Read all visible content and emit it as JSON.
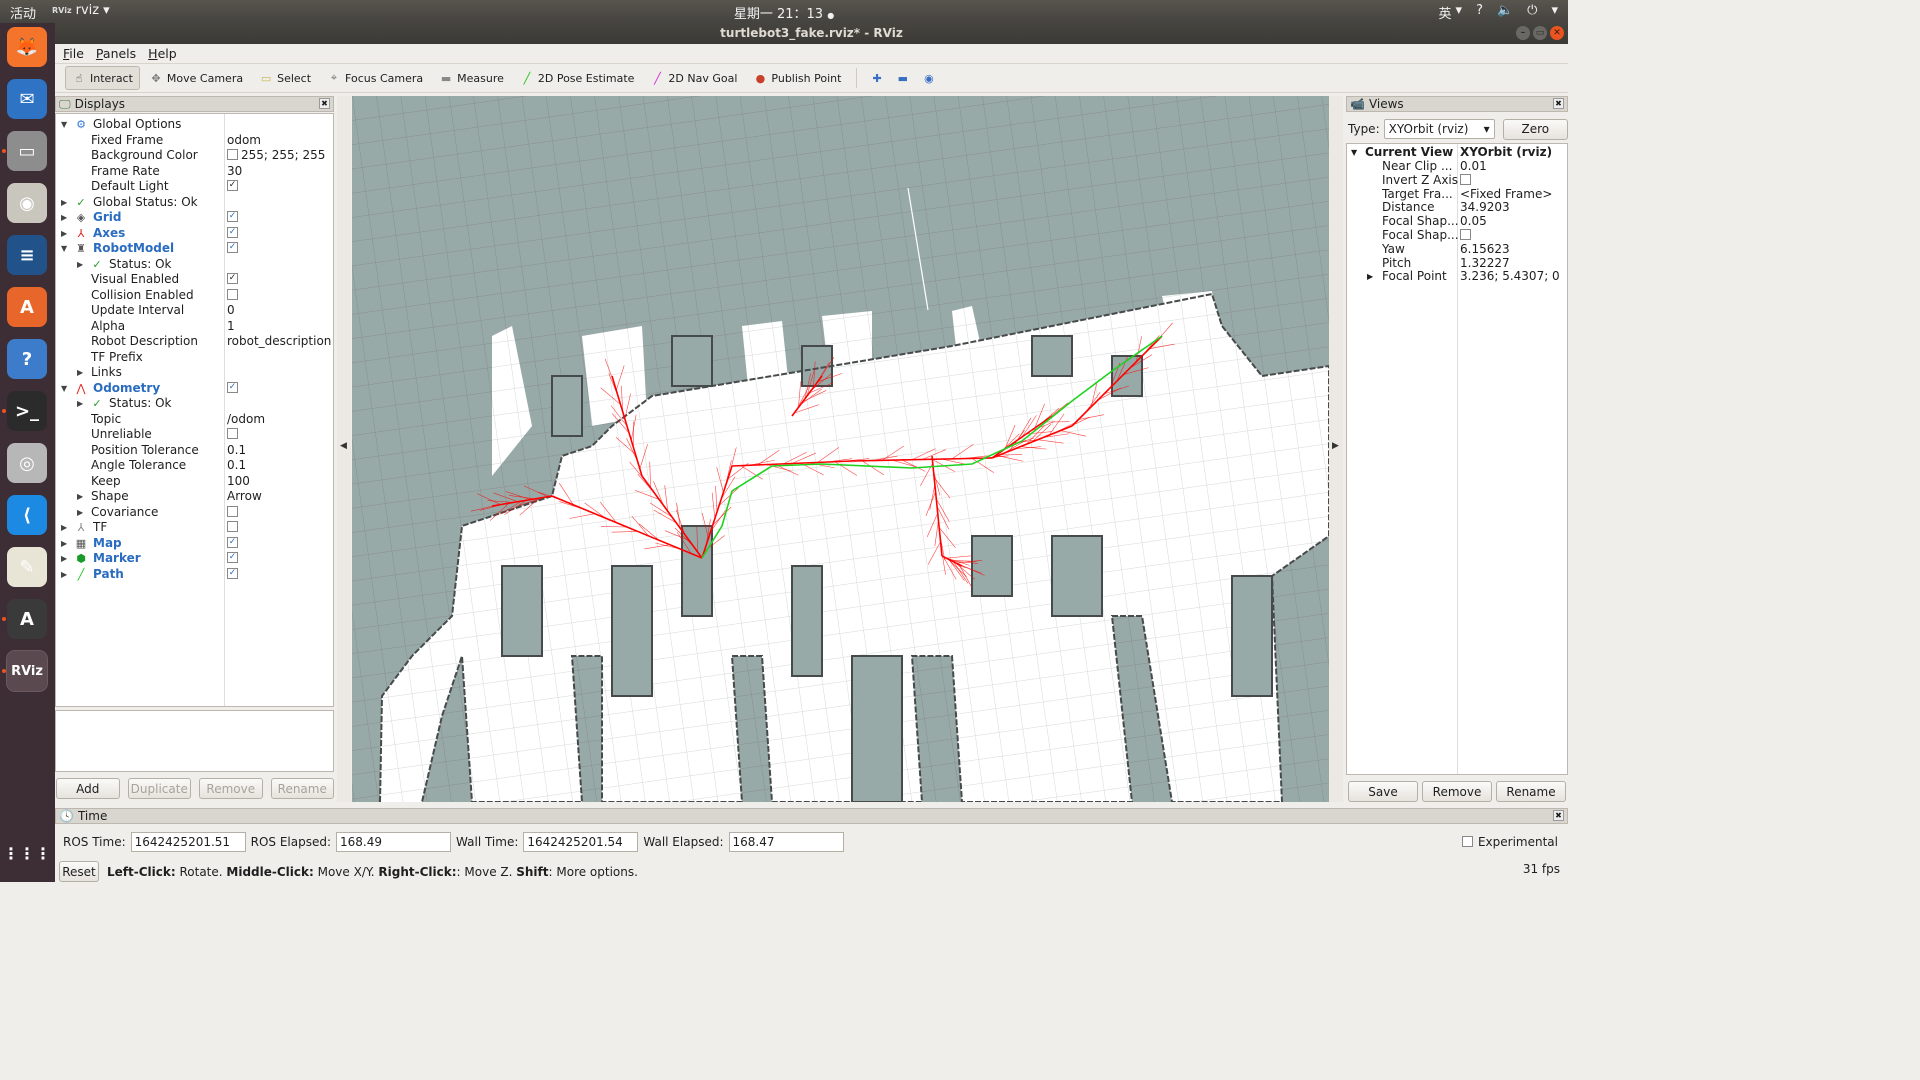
{
  "topbar": {
    "activities": "活动",
    "app_name": "rviz",
    "app_logo": "RViz",
    "clock": "星期一 21：13",
    "tray": {
      "lang": "英",
      "help": "?",
      "volume": "volume-muted-icon",
      "power": "power-icon"
    }
  },
  "dock": {
    "apps": [
      {
        "name": "firefox",
        "icon": "firefox-icon",
        "color": "#f4742c",
        "glyph": "🦊"
      },
      {
        "name": "thunderbird",
        "icon": "thunderbird-icon",
        "color": "#2f73c4",
        "glyph": "✉"
      },
      {
        "name": "files",
        "icon": "files-icon",
        "color": "#8d8d8d",
        "glyph": "▭",
        "running": true
      },
      {
        "name": "rhythmbox",
        "icon": "rhythmbox-icon",
        "color": "#c9c7bd",
        "glyph": "◉"
      },
      {
        "name": "libreoffice-writer",
        "icon": "writer-icon",
        "color": "#21538a",
        "glyph": "≡"
      },
      {
        "name": "software",
        "icon": "software-center-icon",
        "color": "#e8662a",
        "glyph": "A"
      },
      {
        "name": "help",
        "icon": "help-icon",
        "color": "#3d7ccb",
        "glyph": "?"
      },
      {
        "name": "terminal",
        "icon": "terminal-icon",
        "color": "#2b2b2b",
        "glyph": ">_",
        "running": true
      },
      {
        "name": "cheese",
        "icon": "camera-icon",
        "color": "#b7b7b7",
        "glyph": "◎"
      },
      {
        "name": "vscode",
        "icon": "vscode-icon",
        "color": "#1c8ae2",
        "glyph": "⟨"
      },
      {
        "name": "text-editor",
        "icon": "text-editor-icon",
        "color": "#e8e4d6",
        "glyph": "✎"
      },
      {
        "name": "software-updater",
        "icon": "software-updater-icon",
        "color": "#3a3a3a",
        "glyph": "A",
        "running": true
      },
      {
        "name": "rviz",
        "icon": "rviz-icon",
        "color": "#5a4a50",
        "glyph": "RViz",
        "running": true,
        "active": true
      }
    ],
    "show_apps": "show-applications-icon"
  },
  "window": {
    "title": "turtlebot3_fake.rviz* - RViz"
  },
  "menu": [
    "File",
    "Panels",
    "Help"
  ],
  "toolbar": {
    "tools": [
      {
        "label": "Interact",
        "icon": "hand-pointer-icon",
        "glyph": "☝",
        "active": true,
        "color": "#333"
      },
      {
        "label": "Move Camera",
        "icon": "move-camera-icon",
        "glyph": "✥",
        "color": "#777"
      },
      {
        "label": "Select",
        "icon": "select-box-icon",
        "glyph": "▭",
        "color": "#c9b44a"
      },
      {
        "label": "Focus Camera",
        "icon": "focus-camera-icon",
        "glyph": "⌖",
        "color": "#777"
      },
      {
        "label": "Measure",
        "icon": "ruler-icon",
        "glyph": "▬",
        "color": "#888"
      },
      {
        "label": "2D Pose Estimate",
        "icon": "pose-estimate-arrow-icon",
        "glyph": "╱",
        "color": "#19c419"
      },
      {
        "label": "2D Nav Goal",
        "icon": "nav-goal-arrow-icon",
        "glyph": "╱",
        "color": "#d21ed2"
      },
      {
        "label": "Publish Point",
        "icon": "map-pin-icon",
        "glyph": "●",
        "color": "#c8402a"
      }
    ],
    "extra": [
      {
        "icon": "add-tool-icon",
        "glyph": "✚",
        "color": "#3a6fc4"
      },
      {
        "icon": "remove-tool-icon",
        "glyph": "▬",
        "color": "#3a6fc4"
      },
      {
        "icon": "tool-properties-icon",
        "glyph": "◉",
        "color": "#3a6fc4"
      }
    ]
  },
  "displays": {
    "title": "Displays",
    "rows": [
      {
        "level": 0,
        "arrow": "▼",
        "icon": "gear-icon",
        "glyph": "⚙",
        "iconColor": "#3a7bd5",
        "label": "Global Options"
      },
      {
        "level": 1,
        "label": "Fixed Frame",
        "value": "odom"
      },
      {
        "level": 1,
        "label": "Background Color",
        "value": "255; 255; 255",
        "swatch": true
      },
      {
        "level": 1,
        "label": "Frame Rate",
        "value": "30"
      },
      {
        "level": 1,
        "label": "Default Light",
        "check": "✓"
      },
      {
        "level": 0,
        "arrow": "▶",
        "icon": "ok-check-icon",
        "glyph": "✓",
        "iconColor": "#2a9a2a",
        "label": "Global Status: Ok"
      },
      {
        "level": 0,
        "arrow": "▶",
        "icon": "grid-icon",
        "glyph": "◈",
        "iconColor": "#555",
        "label": "Grid",
        "blue": true,
        "check": "✓"
      },
      {
        "level": 0,
        "arrow": "▶",
        "icon": "axes-icon",
        "glyph": "⅄",
        "iconColor": "#d22",
        "label": "Axes",
        "blue": true,
        "check": "✓"
      },
      {
        "level": 0,
        "arrow": "▼",
        "icon": "robot-model-icon",
        "glyph": "♜",
        "iconColor": "#555",
        "label": "RobotModel",
        "blue": true,
        "check": "✓"
      },
      {
        "level": 1,
        "arrow": "▶",
        "icon": "ok-check-icon",
        "glyph": "✓",
        "iconColor": "#2a9a2a",
        "label": "Status: Ok"
      },
      {
        "level": 1,
        "label": "Visual Enabled",
        "check": "✓"
      },
      {
        "level": 1,
        "label": "Collision Enabled",
        "check": ""
      },
      {
        "level": 1,
        "label": "Update Interval",
        "value": "0"
      },
      {
        "level": 1,
        "label": "Alpha",
        "value": "1"
      },
      {
        "level": 1,
        "label": "Robot Description",
        "value": "robot_description"
      },
      {
        "level": 1,
        "label": "TF Prefix",
        "value": ""
      },
      {
        "level": 1,
        "arrow": "▶",
        "label": "Links"
      },
      {
        "level": 0,
        "arrow": "▼",
        "icon": "odometry-icon",
        "glyph": "⋀",
        "iconColor": "#d22",
        "label": "Odometry",
        "blue": true,
        "check": "✓"
      },
      {
        "level": 1,
        "arrow": "▶",
        "icon": "ok-check-icon",
        "glyph": "✓",
        "iconColor": "#2a9a2a",
        "label": "Status: Ok"
      },
      {
        "level": 1,
        "label": "Topic",
        "value": "/odom"
      },
      {
        "level": 1,
        "label": "Unreliable",
        "check": ""
      },
      {
        "level": 1,
        "label": "Position Tolerance",
        "value": "0.1"
      },
      {
        "level": 1,
        "label": "Angle Tolerance",
        "value": "0.1"
      },
      {
        "level": 1,
        "label": "Keep",
        "value": "100"
      },
      {
        "level": 1,
        "arrow": "▶",
        "label": "Shape",
        "value": "Arrow"
      },
      {
        "level": 1,
        "arrow": "▶",
        "label": "Covariance",
        "check": ""
      },
      {
        "level": 0,
        "arrow": "▶",
        "icon": "tf-icon",
        "glyph": "⅄",
        "iconColor": "#888",
        "label": "TF",
        "check": ""
      },
      {
        "level": 0,
        "arrow": "▶",
        "icon": "map-icon",
        "glyph": "▦",
        "iconColor": "#555",
        "label": "Map",
        "blue": true,
        "check": "✓"
      },
      {
        "level": 0,
        "arrow": "▶",
        "icon": "marker-icon",
        "glyph": "⬢",
        "iconColor": "#1a9a2a",
        "label": "Marker",
        "blue": true,
        "check": "✓"
      },
      {
        "level": 0,
        "arrow": "▶",
        "icon": "path-icon",
        "glyph": "╱",
        "iconColor": "#1ac41a",
        "label": "Path",
        "blue": true,
        "check": "✓"
      }
    ],
    "buttons": [
      {
        "label": "Add",
        "enabled": true
      },
      {
        "label": "Duplicate",
        "enabled": false
      },
      {
        "label": "Remove",
        "enabled": false
      },
      {
        "label": "Rename",
        "enabled": false
      }
    ]
  },
  "views": {
    "title": "Views",
    "type_label": "Type:",
    "type_value": "XYOrbit (rviz)",
    "zero_label": "Zero",
    "current": {
      "label": "Current View",
      "value": "XYOrbit (rviz)"
    },
    "rows": [
      {
        "label": "Near Clip ...",
        "value": "0.01"
      },
      {
        "label": "Invert Z Axis",
        "check": ""
      },
      {
        "label": "Target Fra...",
        "value": "<Fixed Frame>"
      },
      {
        "label": "Distance",
        "value": "34.9203"
      },
      {
        "label": "Focal Shap...",
        "value": "0.05"
      },
      {
        "label": "Focal Shap...",
        "check": ""
      },
      {
        "label": "Yaw",
        "value": "6.15623"
      },
      {
        "label": "Pitch",
        "value": "1.32227"
      },
      {
        "label": "Focal Point",
        "value": "3.236; 5.4307; 0",
        "arrow": "▶"
      }
    ],
    "buttons": [
      "Save",
      "Remove",
      "Rename"
    ]
  },
  "time": {
    "title": "Time",
    "ros_time_label": "ROS Time:",
    "ros_time": "1642425201.51",
    "ros_elapsed_label": "ROS Elapsed:",
    "ros_elapsed": "168.49",
    "wall_time_label": "Wall Time:",
    "wall_time": "1642425201.54",
    "wall_elapsed_label": "Wall Elapsed:",
    "wall_elapsed": "168.47",
    "experimental_label": "Experimental",
    "reset_label": "Reset",
    "hint": [
      {
        "b": "Left-Click:",
        "t": " Rotate. "
      },
      {
        "b": "Middle-Click:",
        "t": " Move X/Y. "
      },
      {
        "b": "Right-Click:",
        "t": ": Move Z. "
      },
      {
        "b": "Shift",
        "t": ": More options."
      }
    ],
    "fps": "31 fps"
  },
  "viewport": {
    "background": "#98aaa8",
    "free_space": "#ffffff",
    "obstacle": "#474a4a",
    "grid_line": "#a6adac",
    "odometry_color": "#ff0000",
    "path_color": "#1fd21f"
  }
}
